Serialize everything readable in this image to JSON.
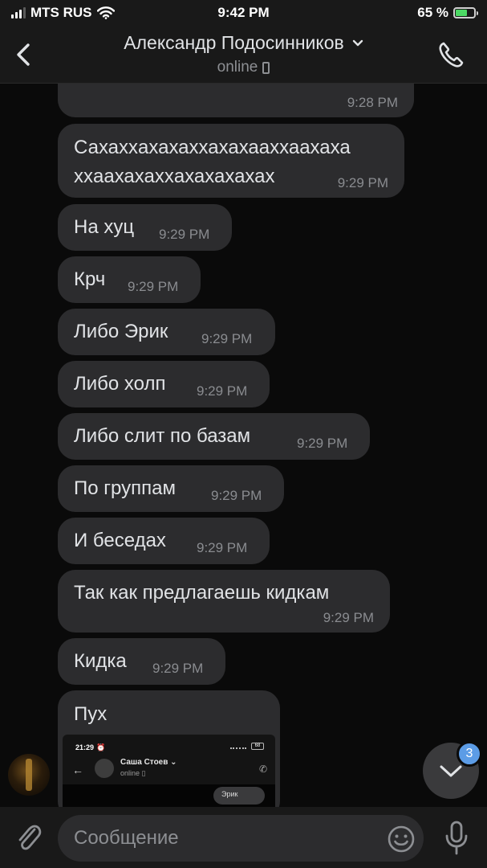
{
  "status_bar": {
    "carrier": "MTS RUS",
    "time": "9:42 PM",
    "battery": "65 %"
  },
  "header": {
    "title": "Александр Подосинников",
    "status": "online"
  },
  "messages": [
    {
      "text": "",
      "time": "9:28 PM"
    },
    {
      "text_lines": [
        "Сахахxахахаххахахааххаахаха",
        "xxаахахаxxахахахахах"
      ],
      "time": "9:29 PM"
    },
    {
      "text": "На хуц",
      "time": "9:29 PM"
    },
    {
      "text": "Крч",
      "time": "9:29 PM"
    },
    {
      "text": "Либо Эрик",
      "time": "9:29 PM"
    },
    {
      "text": "Либо холп",
      "time": "9:29 PM"
    },
    {
      "text": "Либо слит по базам",
      "time": "9:29 PM"
    },
    {
      "text": "По группам",
      "time": "9:29 PM"
    },
    {
      "text": "И беседах",
      "time": "9:29 PM"
    },
    {
      "text": "Так как предлагаешь кидкам",
      "time": "9:29 PM"
    },
    {
      "text": "Кидка",
      "time": "9:29 PM"
    },
    {
      "text": "Пух"
    }
  ],
  "screenshot_preview": {
    "time": "21:29",
    "alarm_icon": "⏰",
    "battery": "68",
    "contact_name": "Саша Стоев ⌄",
    "contact_status": "online ▯",
    "message": "Эрик"
  },
  "scroll_down": {
    "unread_count": "3"
  },
  "composer": {
    "placeholder": "Сообщение",
    "value": ""
  },
  "colors": {
    "background": "#0a0a0a",
    "bubble": "#2c2c2e",
    "badge": "#5c9ce6",
    "battery_fill": "#4cd964"
  }
}
